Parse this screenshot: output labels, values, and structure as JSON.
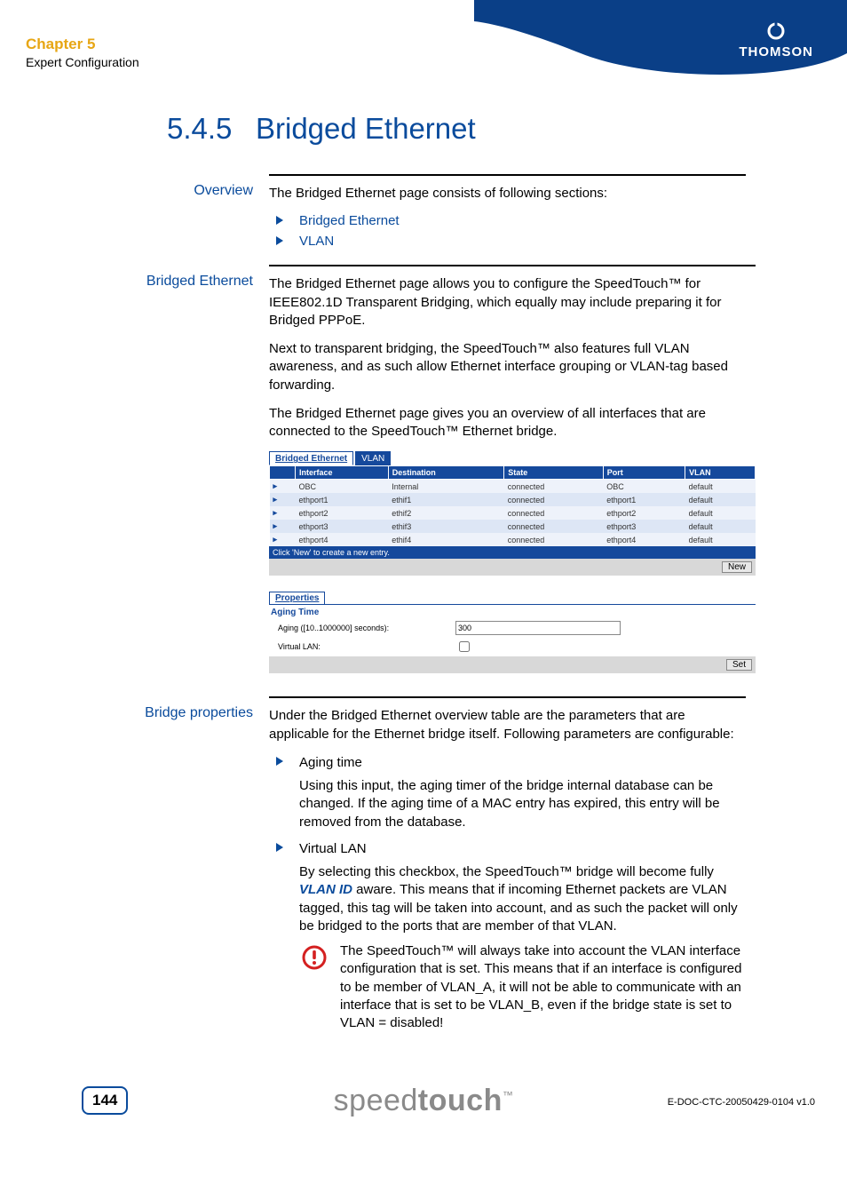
{
  "header": {
    "chapter": "Chapter 5",
    "subtitle": "Expert Configuration",
    "brand": "THOMSON"
  },
  "section": {
    "number": "5.4.5",
    "title": "Bridged Ethernet"
  },
  "overview": {
    "label": "Overview",
    "intro": "The Bridged Ethernet page consists of following sections:",
    "items": [
      "Bridged Ethernet",
      "VLAN"
    ]
  },
  "bridged": {
    "label": "Bridged Ethernet",
    "p1": "The Bridged Ethernet page allows you to configure the SpeedTouch™ for IEEE802.1D Transparent Bridging, which equally may include preparing it for Bridged PPPoE.",
    "p2": "Next to transparent bridging, the SpeedTouch™ also features full VLAN awareness, and as such allow Ethernet interface grouping or VLAN-tag based forwarding.",
    "p3": "The Bridged Ethernet page gives you an overview of all interfaces that are connected to the SpeedTouch™ Ethernet bridge."
  },
  "ui": {
    "tabs": {
      "active": "Bridged Ethernet",
      "other": "VLAN"
    },
    "columns": [
      "",
      "Interface",
      "Destination",
      "State",
      "Port",
      "VLAN"
    ],
    "rows": [
      {
        "interface": "OBC",
        "destination": "Internal",
        "state": "connected",
        "port": "OBC",
        "vlan": "default"
      },
      {
        "interface": "ethport1",
        "destination": "ethif1",
        "state": "connected",
        "port": "ethport1",
        "vlan": "default"
      },
      {
        "interface": "ethport2",
        "destination": "ethif2",
        "state": "connected",
        "port": "ethport2",
        "vlan": "default"
      },
      {
        "interface": "ethport3",
        "destination": "ethif3",
        "state": "connected",
        "port": "ethport3",
        "vlan": "default"
      },
      {
        "interface": "ethport4",
        "destination": "ethif4",
        "state": "connected",
        "port": "ethport4",
        "vlan": "default"
      }
    ],
    "hint": "Click 'New' to create a new entry.",
    "new_btn": "New",
    "properties_tab": "Properties",
    "aging_heading": "Aging Time",
    "aging_label": "Aging ([10..1000000] seconds):",
    "aging_value": "300",
    "vlan_label": "Virtual LAN:",
    "set_btn": "Set"
  },
  "properties": {
    "label": "Bridge properties",
    "intro": "Under the Bridged Ethernet overview table are the parameters that are applicable for the Ethernet bridge itself. Following parameters are configurable:",
    "items": [
      {
        "title": "Aging time",
        "body": "Using this input, the aging timer of the bridge internal database can be changed. If the aging time of a MAC entry has expired, this entry will be removed from the database."
      },
      {
        "title": "Virtual LAN",
        "body_pre": "By selecting this checkbox, the SpeedTouch™ bridge will become fully ",
        "vlanid": "VLAN ID",
        "body_post": " aware. This means that if incoming Ethernet packets are VLAN tagged, this tag will be taken into account, and as such the packet will only be bridged to the ports that are member of that VLAN."
      }
    ],
    "warning": "The SpeedTouch™ will always take into account the VLAN interface configuration that is set. This means that if an interface is configured to be member of VLAN_A, it will not be able to communicate with an interface that is set to be VLAN_B, even if the bridge state is set to VLAN = disabled!"
  },
  "footer": {
    "page": "144",
    "product_a": "speed",
    "product_b": "touch",
    "tm": "™",
    "docid": "E-DOC-CTC-20050429-0104 v1.0"
  }
}
